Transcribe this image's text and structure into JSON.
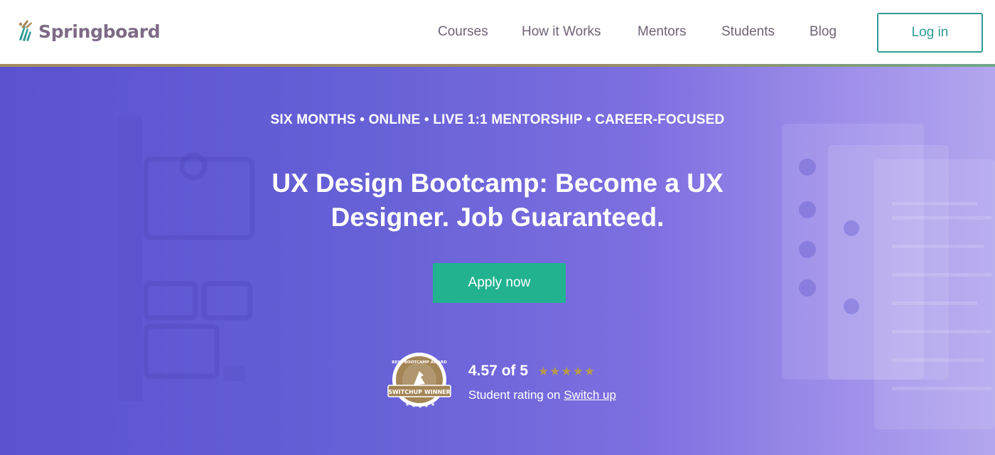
{
  "brand": {
    "name": "Springboard"
  },
  "nav": {
    "items": [
      "Courses",
      "How it Works",
      "Mentors",
      "Students",
      "Blog"
    ],
    "login_label": "Log in"
  },
  "hero": {
    "eyebrow": "SIX MONTHS • ONLINE • LIVE 1:1 MENTORSHIP • CAREER-FOCUSED",
    "headline": "UX Design Bootcamp: Become a UX Designer. Job Guaranteed.",
    "cta_label": "Apply now"
  },
  "rating": {
    "value_text": "4.57 of 5",
    "stars": 5,
    "sub_prefix": "Student rating on ",
    "sub_link": "Switch up",
    "badge_top": "BEST BOOTCAMP AWARD",
    "badge_ribbon": "SWITCHUP WINNER"
  },
  "colors": {
    "accent": "#2e9c95",
    "cta": "#22b290",
    "hero_start": "#5b52cf",
    "hero_end": "#b3a6ee",
    "star": "#b89a4c",
    "logo_text": "#7d6a85"
  }
}
